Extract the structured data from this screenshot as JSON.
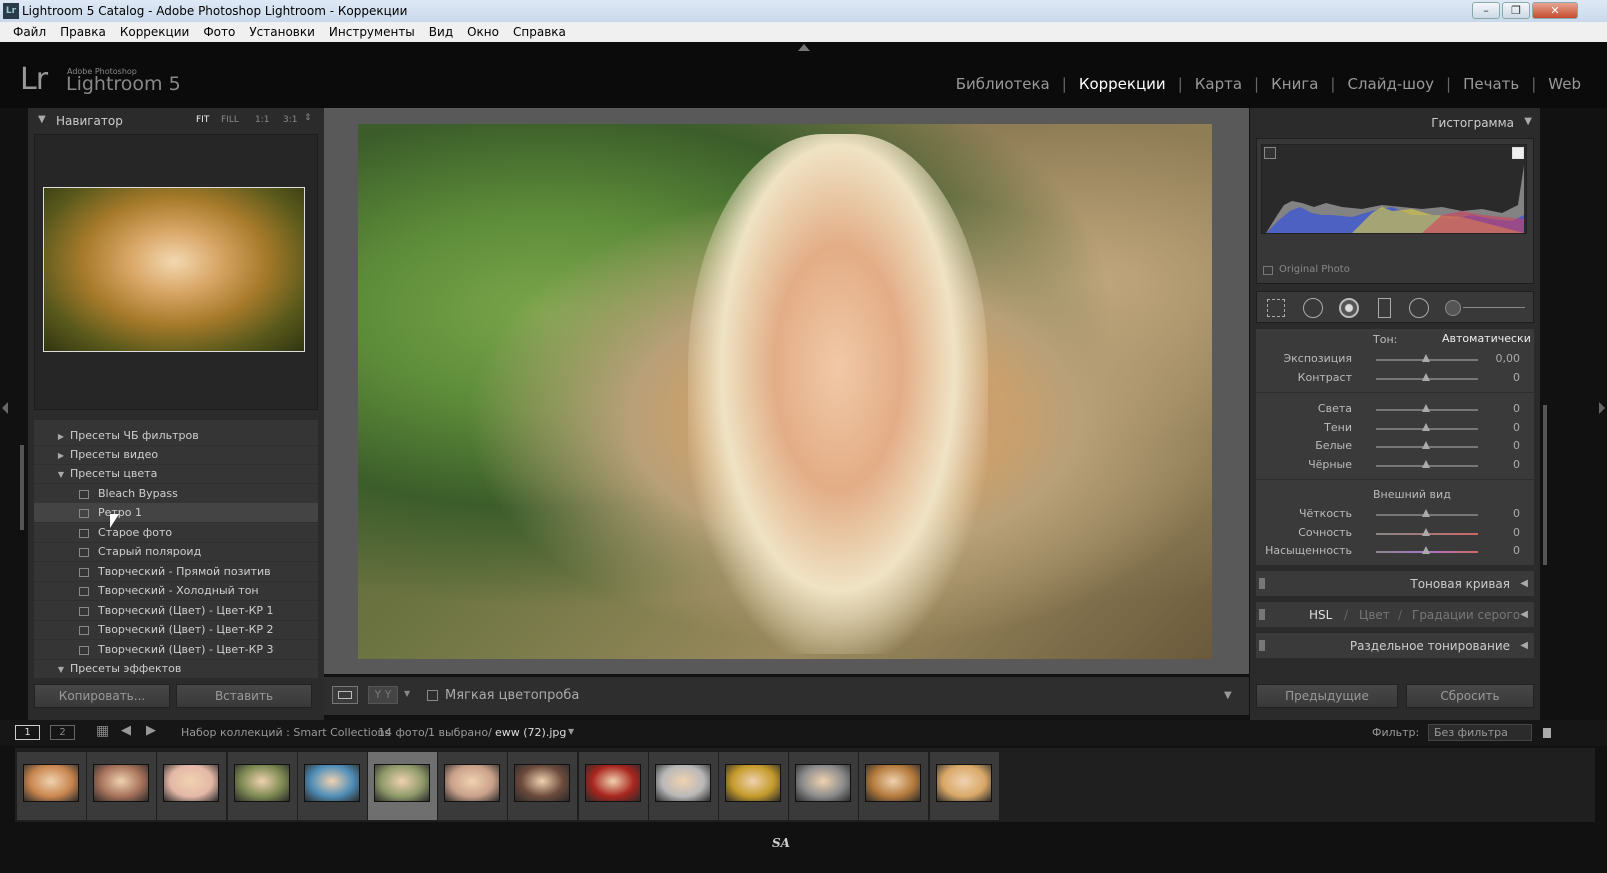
{
  "window": {
    "title": "Lightroom 5 Catalog - Adobe Photoshop Lightroom - Коррекции",
    "app_icon": "Lr"
  },
  "menu": [
    "Файл",
    "Правка",
    "Коррекции",
    "Фото",
    "Установки",
    "Инструменты",
    "Вид",
    "Окно",
    "Справка"
  ],
  "identity": {
    "logo": "Lr",
    "brand_small": "Adobe Photoshop",
    "brand": "Lightroom 5"
  },
  "modules": [
    {
      "label": "Библиотека"
    },
    {
      "label": "Коррекции",
      "active": true
    },
    {
      "label": "Карта"
    },
    {
      "label": "Книга"
    },
    {
      "label": "Слайд-шоу"
    },
    {
      "label": "Печать"
    },
    {
      "label": "Web"
    }
  ],
  "navigator": {
    "title": "Навигатор",
    "zoom": [
      "FIT",
      "FILL",
      "1:1",
      "3:1"
    ]
  },
  "presets": {
    "items": [
      {
        "label": "Пресеты ЧБ фильтров",
        "type": "folder",
        "expanded": false
      },
      {
        "label": "Пресеты видео",
        "type": "folder",
        "expanded": false
      },
      {
        "label": "Пресеты цвета",
        "type": "folder",
        "expanded": true
      },
      {
        "label": "Bleach Bypass",
        "type": "preset"
      },
      {
        "label": "Ретро 1",
        "type": "preset",
        "selected": true
      },
      {
        "label": "Старое фото",
        "type": "preset"
      },
      {
        "label": "Старый поляроид",
        "type": "preset"
      },
      {
        "label": "Творческий - Прямой позитив",
        "type": "preset"
      },
      {
        "label": "Творческий - Холодный тон",
        "type": "preset"
      },
      {
        "label": "Творческий (Цвет) - Цвет-КР 1",
        "type": "preset"
      },
      {
        "label": "Творческий (Цвет) - Цвет-КР 2",
        "type": "preset"
      },
      {
        "label": "Творческий (Цвет) - Цвет-КР 3",
        "type": "preset"
      },
      {
        "label": "Пресеты эффектов",
        "type": "folder",
        "expanded": true
      }
    ],
    "copy_button": "Копировать...",
    "paste_button": "Вставить"
  },
  "toolbar": {
    "soft_proof": "Мягкая цветопроба",
    "yy": "Y Y"
  },
  "histogram": {
    "title": "Гистограмма",
    "original_photo": "Original Photo"
  },
  "basic": {
    "tone_label": "Тон:",
    "auto": "Автоматически",
    "sliders_tone": [
      {
        "label": "Экспозиция",
        "value": "0,00",
        "pos": 0.5
      },
      {
        "label": "Контраст",
        "value": "0",
        "pos": 0.5
      }
    ],
    "sliders_light": [
      {
        "label": "Света",
        "value": "0",
        "pos": 0.5
      },
      {
        "label": "Тени",
        "value": "0",
        "pos": 0.5
      },
      {
        "label": "Белые",
        "value": "0",
        "pos": 0.5
      },
      {
        "label": "Чёрные",
        "value": "0",
        "pos": 0.5
      }
    ],
    "presence_label": "Внешний вид",
    "sliders_presence": [
      {
        "label": "Чёткость",
        "value": "0",
        "pos": 0.5
      },
      {
        "label": "Сочность",
        "value": "0",
        "pos": 0.5
      },
      {
        "label": "Насыщенность",
        "value": "0",
        "pos": 0.5
      }
    ]
  },
  "right_panels": {
    "tone_curve": "Тоновая кривая",
    "hsl": "HSL",
    "color": "Цвет",
    "grayscale": "Градации серого",
    "split_toning": "Раздельное тонирование"
  },
  "right_buttons": {
    "previous": "Предыдущие",
    "reset": "Сбросить"
  },
  "filmbar": {
    "screen1": "1",
    "screen2": "2",
    "source": "Набор коллекций : Smart Collections",
    "count": "14 фото/",
    "selected": "1 выбрано/",
    "filename": "eww (72).jpg",
    "filter_label": "Фильтр:",
    "filter_value": "Без фильтра"
  },
  "filmstrip": {
    "count": 14,
    "selected_index": 5,
    "colors": [
      "#c9864f",
      "#a6715a",
      "#e4b8a7",
      "#7d8a52",
      "#4f8eb8",
      "#8f9a6a",
      "#c9a08a",
      "#6b4a3c",
      "#a8251e",
      "#b8b8b8",
      "#c49a2a",
      "#8c8c8c",
      "#b47a3c",
      "#d9a868"
    ]
  },
  "signature": "SA"
}
